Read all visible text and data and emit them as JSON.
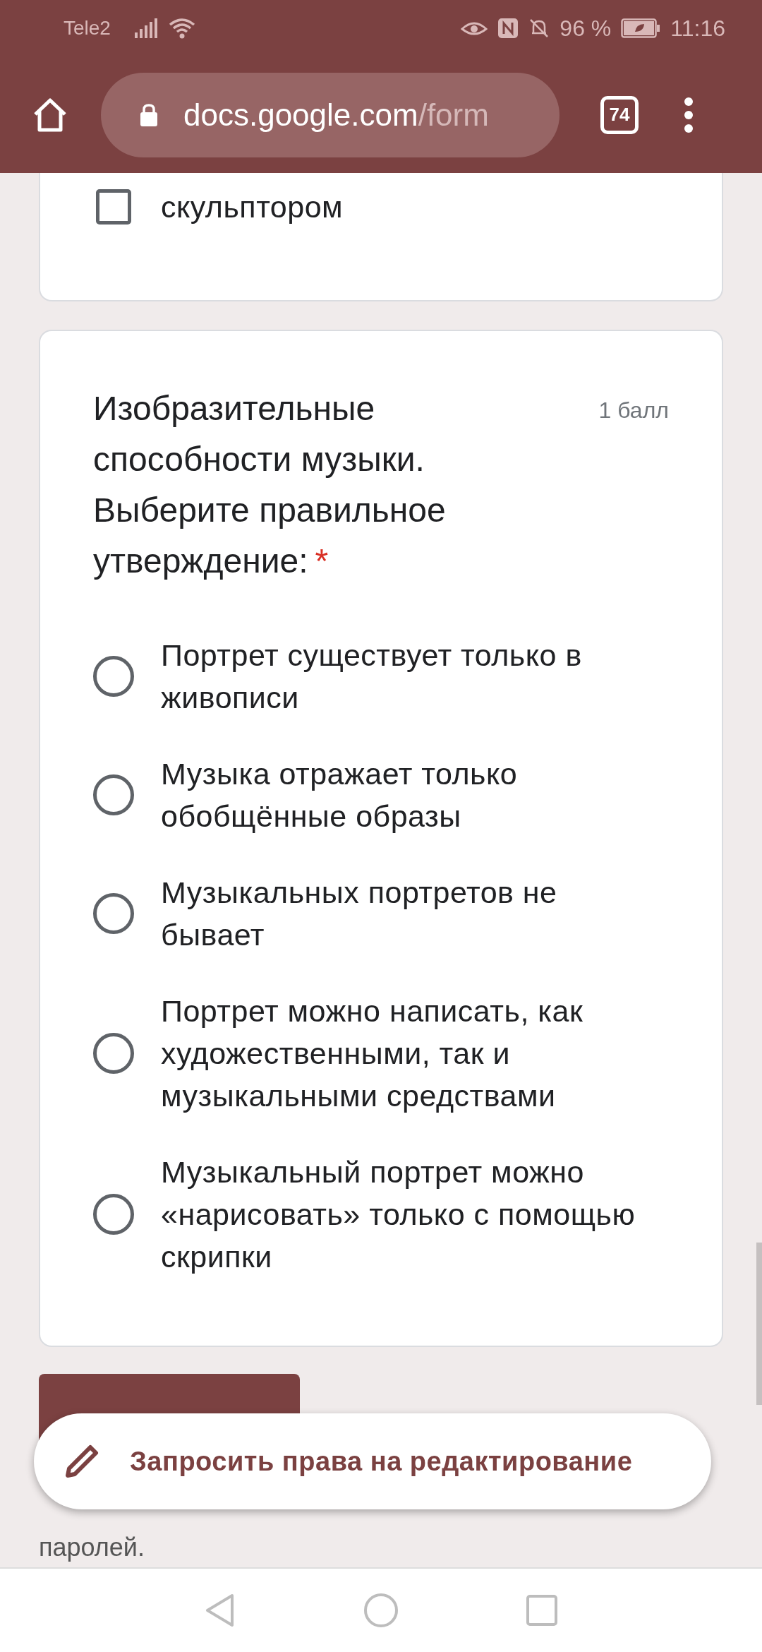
{
  "status_bar": {
    "carrier": "Tele2",
    "battery": "96 %",
    "time": "11:16"
  },
  "browser": {
    "url_host": "docs.google.com",
    "url_path": "/form",
    "tab_count": "74"
  },
  "previous_question": {
    "options": [
      {
        "label": "скульптором",
        "checked": false
      }
    ]
  },
  "question": {
    "title": "Изобразительные способности музыки. Выберите правильное утверждение:",
    "required": true,
    "required_mark": "*",
    "points": "1 балл",
    "options": [
      {
        "label": "Портрет существует только в живописи",
        "selected": false
      },
      {
        "label": "Музыка отражает только обобщённые образы",
        "selected": false
      },
      {
        "label": "Музыкальных портретов не бывает",
        "selected": false
      },
      {
        "label": "Портрет можно написать, как художественными, так и музыкальными средствами",
        "selected": false
      },
      {
        "label": "Музыкальный портрет можно «нарисовать» только с помощью скрипки",
        "selected": false
      }
    ]
  },
  "snackbar": {
    "label": "Запросить права на редактирование"
  },
  "footer_note": "паролей."
}
